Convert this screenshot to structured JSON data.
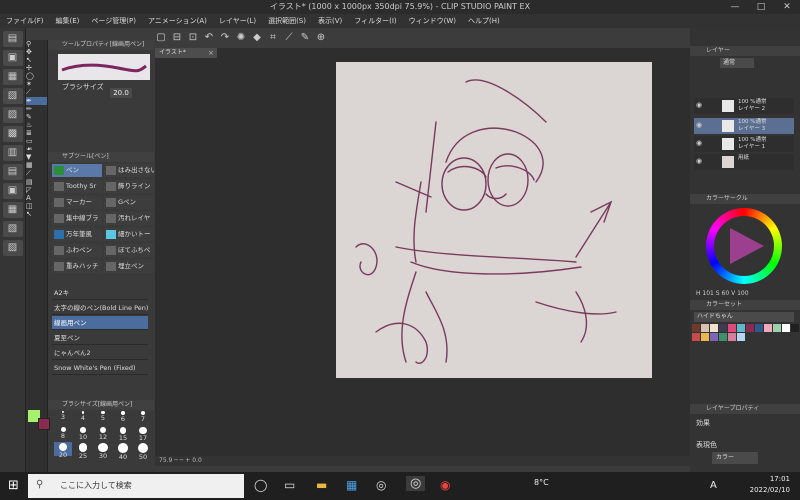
{
  "window": {
    "title": "イラスト* (1000 x 1000px 350dpi 75.9%) - CLIP STUDIO PAINT EX",
    "minimize": "—",
    "maximize": "□",
    "close": "✕"
  },
  "menu": [
    "ファイル(F)",
    "編集(E)",
    "ページ管理(P)",
    "アニメーション(A)",
    "レイヤー(L)",
    "選択範囲(S)",
    "表示(V)",
    "フィルター(I)",
    "ウィンドウ(W)",
    "ヘルプ(H)"
  ],
  "tool_property": {
    "header": "ツールプロパティ[線画用ペン]",
    "brush_size_label": "ブラシサイズ",
    "brush_size_value": "20.0"
  },
  "sub_tool": {
    "header": "サブツール[ペン]",
    "items": [
      "ペン",
      "はみ出さない",
      "Toothy Sr",
      "飾りライン",
      "マーカー",
      "Gペン",
      "集中線ブラ",
      "汚れレイヤ",
      "万年筆風",
      "細かいトー",
      "ふわペン",
      "ぼてふちペ",
      "重みハッチ",
      "埋立ペン"
    ]
  },
  "brush_list": {
    "items": [
      "A2キ",
      "太字の線のペン(Bold Line Pen)",
      "線画用ペン",
      "夏至ペン",
      "にゃんぺん2",
      "Snow White's Pen (Fixed)"
    ],
    "selected_index": 2
  },
  "brush_size_palette": {
    "header": "ブラシサイズ[線画用ペン]",
    "sizes": [
      "3",
      "4",
      "5",
      "6",
      "7",
      "8",
      "10",
      "12",
      "15",
      "17",
      "20",
      "25",
      "30",
      "40",
      "50"
    ]
  },
  "canvas": {
    "tab_label": "イラスト*",
    "zoom": "75.9",
    "status": "75.9 ─  ─ + 0.0"
  },
  "layers": {
    "header": "レイヤー",
    "blend_mode": "通常",
    "items": [
      {
        "percent": "100 %通常",
        "name": "レイヤー 2"
      },
      {
        "percent": "100 %通常",
        "name": "レイヤー 3"
      },
      {
        "percent": "100 %通常",
        "name": "レイヤー 1"
      },
      {
        "percent": "",
        "name": "用紙"
      }
    ],
    "selected_index": 1
  },
  "color": {
    "header": "カラーサークル",
    "h": "101",
    "s": "60",
    "v": "100",
    "main_color": "#a6f26d",
    "sub_color": "#8a2a52"
  },
  "color_set": {
    "header": "カラーセット",
    "set_name": "ハイドちゃん",
    "swatches": [
      "#6d3b2e",
      "#d9c1b1",
      "#f2e1d0",
      "#3d3b4f",
      "#e04a7a",
      "#5bb7c9",
      "#8a2a52",
      "#2d5a8a",
      "#f5a9b8",
      "#9bd3ae",
      "#ffffff",
      "#202020",
      "#c94a4a",
      "#eab74f",
      "#7c64b8",
      "#3e8f6b",
      "#d77d9b",
      "#b4d6f0"
    ]
  },
  "layer_property": {
    "header": "レイヤープロパティ",
    "effect_label": "効果",
    "display_color_label": "表現色",
    "display_color_value": "カラー"
  },
  "taskbar": {
    "search_placeholder": "ここに入力して検索",
    "weather": "8°C",
    "ime": "A",
    "time": "17:01",
    "date": "2022/02/10"
  }
}
